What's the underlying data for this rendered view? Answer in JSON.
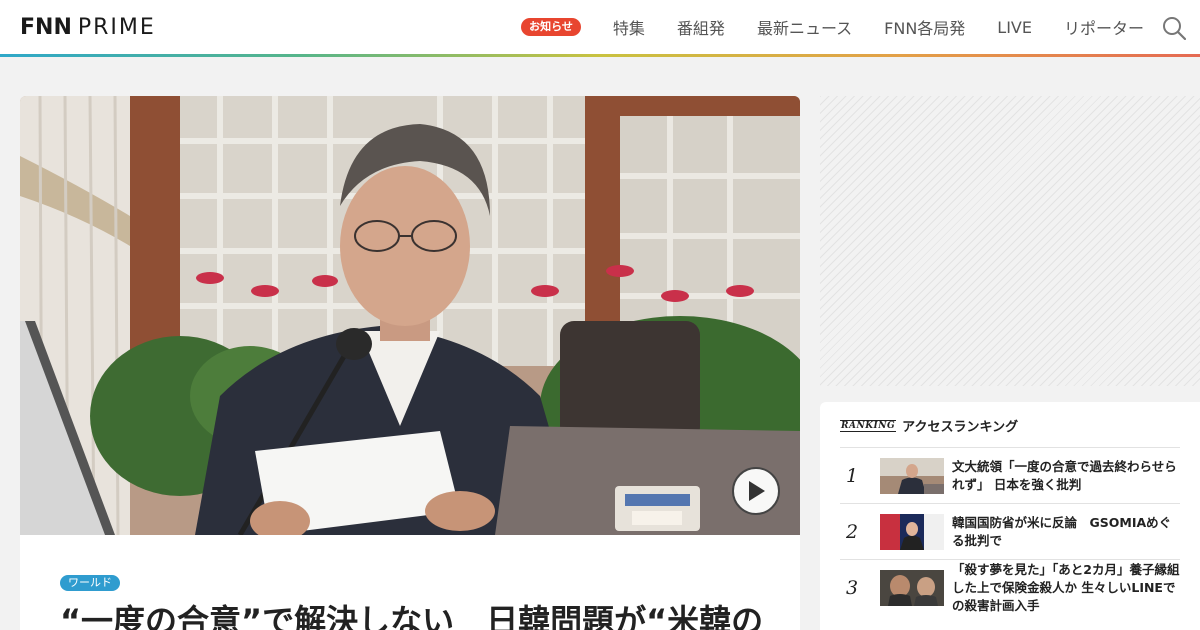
{
  "header": {
    "logo_fnn": "FNN",
    "logo_prime": "PRIME",
    "notice_label": "お知らせ",
    "nav": [
      {
        "label": "特集"
      },
      {
        "label": "番組発"
      },
      {
        "label": "最新ニュース"
      },
      {
        "label": "FNN各局発"
      },
      {
        "label": "LIVE"
      },
      {
        "label": "リポーター"
      }
    ],
    "search_icon": "search-icon"
  },
  "hero": {
    "category": "ワールド",
    "headline": "“一度の合意”で解決しない　日韓問題が“米韓の",
    "play_icon": "play-icon"
  },
  "ranking": {
    "logo_text": "RANKING",
    "title": "アクセスランキング",
    "items": [
      {
        "rank": "1",
        "text": "文大統領「一度の合意で過去終わらせられず」 日本を強く批判"
      },
      {
        "rank": "2",
        "text": "韓国国防省が米に反論　GSOMIAめぐる批判で"
      },
      {
        "rank": "3",
        "text": "「殺す夢を見た」「あと2カ月」養子縁組した上で保険金殺人か 生々しいLINEでの殺害計画入手"
      }
    ]
  },
  "colors": {
    "accent_red": "#e8452f",
    "category_blue": "#2f9ccf",
    "header_rule_start": "#2fa8c9",
    "header_rule_end": "#e56a53"
  }
}
